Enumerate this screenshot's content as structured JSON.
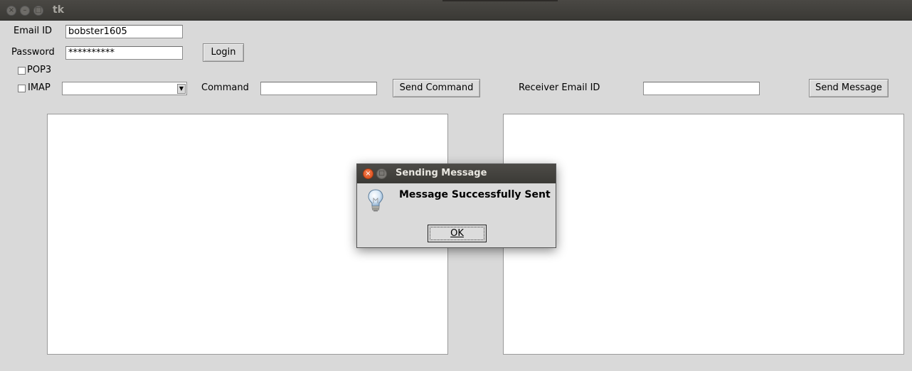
{
  "window": {
    "title": "tk"
  },
  "login": {
    "email_label": "Email ID",
    "email_value": "bobster1605",
    "password_label": "Password",
    "password_value": "**********",
    "login_button": "Login"
  },
  "protocols": {
    "pop3_label": "POP3",
    "imap_label": "IMAP",
    "imap_selected": ""
  },
  "command": {
    "label": "Command",
    "value": "",
    "send_button": "Send Command"
  },
  "receiver": {
    "label": "Receiver Email ID",
    "value": "",
    "send_button": "Send Message"
  },
  "dialog": {
    "title": "Sending Message",
    "message": "Message Successfully Sent",
    "ok_button": "OK",
    "icon": "lightbulb-icon"
  }
}
